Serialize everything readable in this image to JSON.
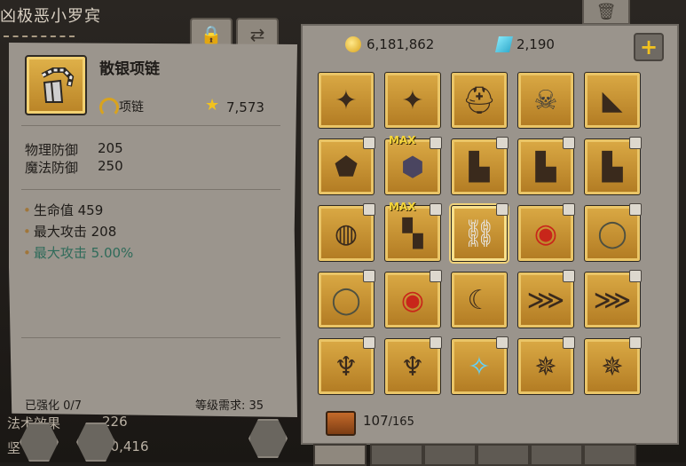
{
  "hero": {
    "name": "凶极恶小罗宾"
  },
  "tooltip": {
    "item_name": "散银项链",
    "item_type": "项链",
    "score": "7,573",
    "base_stats": [
      {
        "label": "物理防御",
        "value": "205"
      },
      {
        "label": "魔法防御",
        "value": "250"
      }
    ],
    "bonus_stats": [
      {
        "text": "生命值 459"
      },
      {
        "text": "最大攻击 208"
      },
      {
        "text": "最大攻击 5.00%"
      }
    ],
    "enhance": "已强化 0/7",
    "level_req": "等级需求: 35"
  },
  "background": {
    "stat1_label": "法术效果",
    "stat1_value": "226",
    "stat2_label": "坚",
    "stat2_value": "30,416"
  },
  "inventory": {
    "gold": "6,181,862",
    "gems": "2,190",
    "capacity_used": "107",
    "capacity_total": "/165",
    "rows": [
      [
        {
          "icon": "staff-icon",
          "lock": false
        },
        {
          "icon": "staff-icon",
          "lock": false
        },
        {
          "icon": "helmet-icon",
          "lock": false
        },
        {
          "icon": "skull-helmet-icon",
          "lock": false
        },
        {
          "icon": "blade-icon",
          "lock": false
        }
      ],
      [
        {
          "icon": "chest-armor-icon",
          "lock": true
        },
        {
          "icon": "dark-armor-icon",
          "lock": true,
          "max": "MAX"
        },
        {
          "icon": "boots-icon",
          "lock": true
        },
        {
          "icon": "boots-icon",
          "lock": true
        },
        {
          "icon": "boots-icon",
          "lock": true
        }
      ],
      [
        {
          "icon": "bracer-icon",
          "lock": true
        },
        {
          "icon": "greaves-icon",
          "lock": true,
          "max": "MAX"
        },
        {
          "icon": "necklace-icon",
          "lock": true,
          "selected": true
        },
        {
          "icon": "ruby-ring-icon",
          "lock": true
        },
        {
          "icon": "ring-icon",
          "lock": true
        }
      ],
      [
        {
          "icon": "ring-icon",
          "lock": true
        },
        {
          "icon": "ruby-ring-icon",
          "lock": true
        },
        {
          "icon": "scythe-icon",
          "lock": false
        },
        {
          "icon": "claw-icon",
          "lock": true
        },
        {
          "icon": "claw-icon",
          "lock": true
        }
      ],
      [
        {
          "icon": "wand-icon",
          "lock": true
        },
        {
          "icon": "wand-icon",
          "lock": true
        },
        {
          "icon": "crystal-sword-icon",
          "lock": true
        },
        {
          "icon": "scepter-icon",
          "lock": true
        },
        {
          "icon": "scepter-icon",
          "lock": true
        }
      ]
    ]
  }
}
